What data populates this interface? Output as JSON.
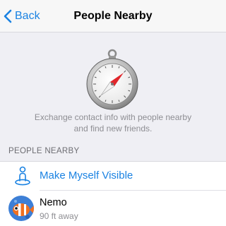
{
  "nav": {
    "back_label": "Back",
    "title": "People Nearby"
  },
  "hero": {
    "icon": "compass-icon",
    "line1": "Exchange contact info with people nearby",
    "line2": "and find new friends."
  },
  "section": {
    "header": "PEOPLE NEARBY"
  },
  "actions": {
    "make_visible_label": "Make Myself Visible",
    "icon": "person-location-icon"
  },
  "users": [
    {
      "name": "Nemo",
      "distance": "90 ft away",
      "avatar_icon": "clownfish-avatar"
    }
  ],
  "colors": {
    "accent": "#1a82e2",
    "background": "#efeff4",
    "secondary_text": "#8e8e93",
    "compass_needle": "#e0262b"
  }
}
